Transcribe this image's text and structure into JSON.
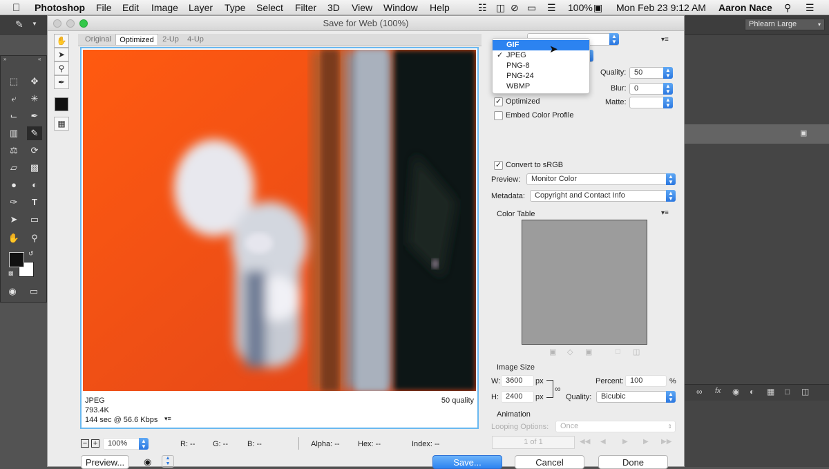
{
  "menubar": {
    "app": "Photoshop",
    "items": [
      "File",
      "Edit",
      "Image",
      "Layer",
      "Type",
      "Select",
      "Filter",
      "3D",
      "View",
      "Window",
      "Help"
    ],
    "battery": "100%",
    "datetime": "Mon Feb 23  9:12 AM",
    "user": "Aaron Nace"
  },
  "workspace": {
    "label": "Phlearn Large"
  },
  "dialog": {
    "title": "Save for Web (100%)",
    "tabs": [
      "Original",
      "Optimized",
      "2-Up",
      "4-Up"
    ],
    "selected_tab": "Optimized",
    "image_info": {
      "format": "JPEG",
      "size": "793.4K",
      "time": "144 sec @ 56.6 Kbps",
      "quality": "50 quality"
    },
    "format_dropdown": {
      "items": [
        "GIF",
        "JPEG",
        "PNG-8",
        "PNG-24",
        "WBMP"
      ],
      "highlighted": "GIF",
      "checked": "JPEG"
    },
    "settings": {
      "quality_label": "Quality:",
      "quality_value": "50",
      "blur_label": "Blur:",
      "blur_value": "0",
      "matte_label": "Matte:",
      "optimized_label": "Optimized",
      "embed_label": "Embed Color Profile",
      "convert_label": "Convert to sRGB",
      "preview_label": "Preview:",
      "preview_value": "Monitor Color",
      "metadata_label": "Metadata:",
      "metadata_value": "Copyright and Contact Info",
      "color_table_label": "Color Table"
    },
    "image_size": {
      "heading": "Image Size",
      "w_label": "W:",
      "w_value": "3600",
      "h_label": "H:",
      "h_value": "2400",
      "unit": "px",
      "percent_label": "Percent:",
      "percent_value": "100",
      "percent_unit": "%",
      "quality_label": "Quality:",
      "quality_value": "Bicubic"
    },
    "animation": {
      "heading": "Animation",
      "looping_label": "Looping Options:",
      "looping_value": "Once",
      "frame": "1 of 1"
    },
    "status": {
      "zoom": "100%",
      "r": "R: --",
      "g": "G: --",
      "b": "B: --",
      "alpha": "Alpha: --",
      "hex": "Hex: --",
      "index": "Index: --"
    },
    "buttons": {
      "preview": "Preview...",
      "save": "Save...",
      "cancel": "Cancel",
      "done": "Done"
    }
  }
}
